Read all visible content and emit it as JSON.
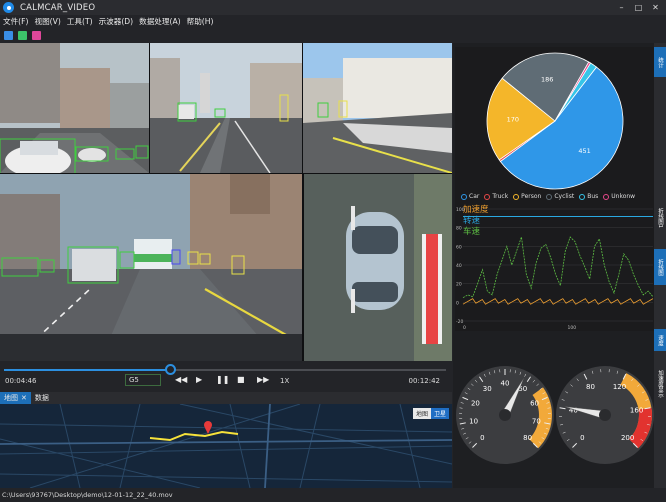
{
  "window": {
    "title": "CALMCAR_VIDEO",
    "minimize": "–",
    "maximize": "□",
    "close": "✕"
  },
  "menu": [
    "文件(F)",
    "视图(V)",
    "工具(T)",
    "示波器(D)",
    "数据处理(A)",
    "帮助(H)"
  ],
  "toolbar": {
    "icons": [
      "folder-icon",
      "document-icon",
      "toolbox-icon"
    ],
    "colors": [
      "#3a8ee6",
      "#3cc46a",
      "#e0479a"
    ]
  },
  "player": {
    "current_time": "00:04:46",
    "total_time": "00:12:42",
    "frame": "G5",
    "speed": "1X",
    "progress": 0.375,
    "buttons": {
      "prev": "◀◀",
      "play": "▶",
      "pause": "❚❚",
      "stop": "■",
      "next": "▶▶"
    }
  },
  "bottom_tabs": [
    {
      "label": "地图",
      "active": true,
      "closable": true
    },
    {
      "label": "数据",
      "active": false,
      "closable": false
    }
  ],
  "map": {
    "toggle": [
      "地图",
      "卫星"
    ],
    "selected": "卫星"
  },
  "right_tabs": {
    "top": [
      "统计"
    ],
    "middle": [
      "折线图1",
      "折线图"
    ],
    "bottom": [
      "速度",
      "加速度显示"
    ]
  },
  "pie": {
    "chart_data": {
      "type": "pie",
      "categories": [
        "Car",
        "Truck",
        "Person",
        "Cyclist",
        "Bus",
        "Unkonw"
      ],
      "values": [
        451,
        4,
        170,
        186,
        14,
        4
      ],
      "labels_shown": [
        "451",
        "170",
        "186"
      ],
      "colors": [
        "#2f97e8",
        "#e84848",
        "#f4b62a",
        "#5f6c75",
        "#36c5e8",
        "#e8478a"
      ]
    }
  },
  "line": {
    "legend": [
      "加速度",
      "转速",
      "车速"
    ],
    "legend_colors": [
      "#f0a030",
      "#2aa8e0",
      "#5ec044"
    ],
    "y_ticks": [
      "100",
      "80",
      "60",
      "40",
      "20",
      "0",
      "-20"
    ],
    "x_ticks": [
      "0",
      "100"
    ]
  },
  "gauges": [
    {
      "name": "speed",
      "ticks": [
        "0",
        "10",
        "20",
        "30",
        "40",
        "50",
        "60",
        "70",
        "80"
      ],
      "value": 48,
      "max": 80
    },
    {
      "name": "rpm",
      "ticks": [
        "0",
        "40",
        "80",
        "120",
        "160",
        "200"
      ],
      "value": 42,
      "max": 200
    }
  ],
  "status": "C:\\Users\\93767\\Desktop\\demo\\12-01-12_22_40.mov"
}
